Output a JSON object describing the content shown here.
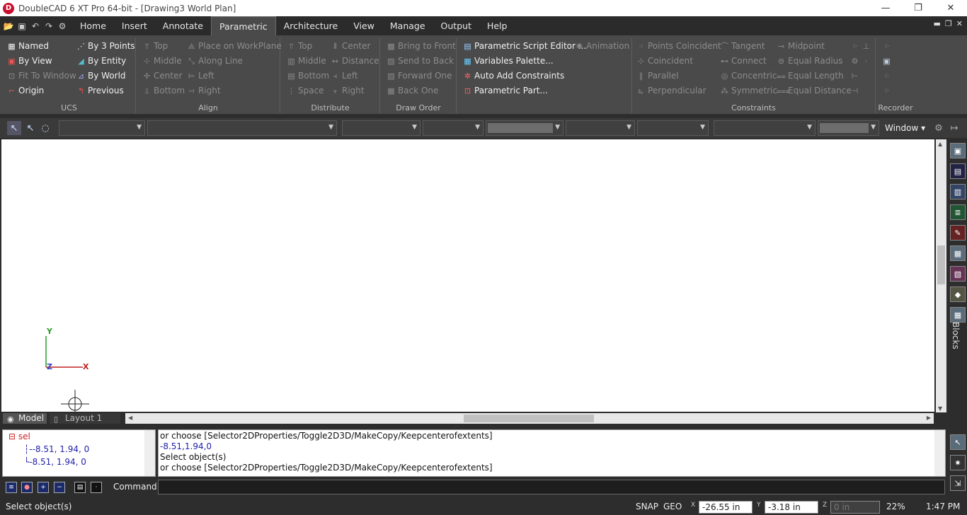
{
  "window": {
    "title": "DoubleCAD 6 XT Pro 64-bit - [Drawing3 World Plan]",
    "logo": "D",
    "minimize": "—",
    "maximize": "❐",
    "close": "✕"
  },
  "menu": {
    "tabs": [
      "Home",
      "Insert",
      "Annotate",
      "Parametric",
      "Architecture",
      "View",
      "Manage",
      "Output",
      "Help"
    ],
    "active_tab": "Parametric"
  },
  "ribbon": {
    "ucs": {
      "label": "UCS",
      "items": [
        "Named",
        "By View",
        "Fit To Window",
        "Origin",
        "By 3 Points",
        "By Entity",
        "By World",
        "Previous"
      ]
    },
    "align": {
      "label": "Align",
      "items": [
        "Top",
        "Middle",
        "Center",
        "Bottom",
        "Place on WorkPlane",
        "Along Line",
        "Left",
        "Right"
      ]
    },
    "distribute": {
      "label": "Distribute",
      "items": [
        "Top",
        "Middle",
        "Bottom",
        "Space",
        "Center",
        "Distance",
        "Left",
        "Right"
      ]
    },
    "draw_order": {
      "label": "Draw Order",
      "items": [
        "Bring to Front",
        "Send to Back",
        "Forward One",
        "Back One"
      ]
    },
    "parametric": {
      "items": [
        "Parametric Script Editor ...",
        "Variables Palette...",
        "Auto Add Constraints",
        "Parametric Part...",
        "Animation"
      ]
    },
    "constraints": {
      "label": "Constraints",
      "items": [
        "Points Coincident",
        "Coincident",
        "Parallel",
        "Perpendicular",
        "Tangent",
        "Connect",
        "Concentric",
        "Symmetric",
        "Midpoint",
        "Equal Radius",
        "Equal Length",
        "Equal Distance"
      ]
    },
    "recorder": {
      "label": "Recorder"
    }
  },
  "toolbar": {
    "window_label": "Window ▾"
  },
  "canvas": {
    "axis_y": "Y",
    "axis_z": "Z",
    "axis_x": "X"
  },
  "layout_tabs": [
    "Model",
    "Layout 1"
  ],
  "right_panel": {
    "blocks_label": "Blocks"
  },
  "tree": {
    "root": "sel",
    "children": [
      "-8.51, 1.94, 0",
      "-8.51, 1.94, 0"
    ]
  },
  "history": [
    "  or choose [Selector2DProperties/Toggle2D3D/MakeCopy/Keepcenterofextents]",
    "-8.51,1.94,0",
    "Select object(s)",
    "  or choose [Selector2DProperties/Toggle2D3D/MakeCopy/Keepcenterofextents]"
  ],
  "command": {
    "label": "Command:",
    "value": ""
  },
  "status": {
    "prompt": "Select object(s)",
    "snap": "SNAP",
    "geo": "GEO",
    "x_value": "-26.55 in",
    "y_value": "-3.18 in",
    "z_value": "0 in",
    "x_axis": "X",
    "y_axis": "Y",
    "z_axis": "Z",
    "zoom": "22%",
    "time": "1:47 PM"
  }
}
